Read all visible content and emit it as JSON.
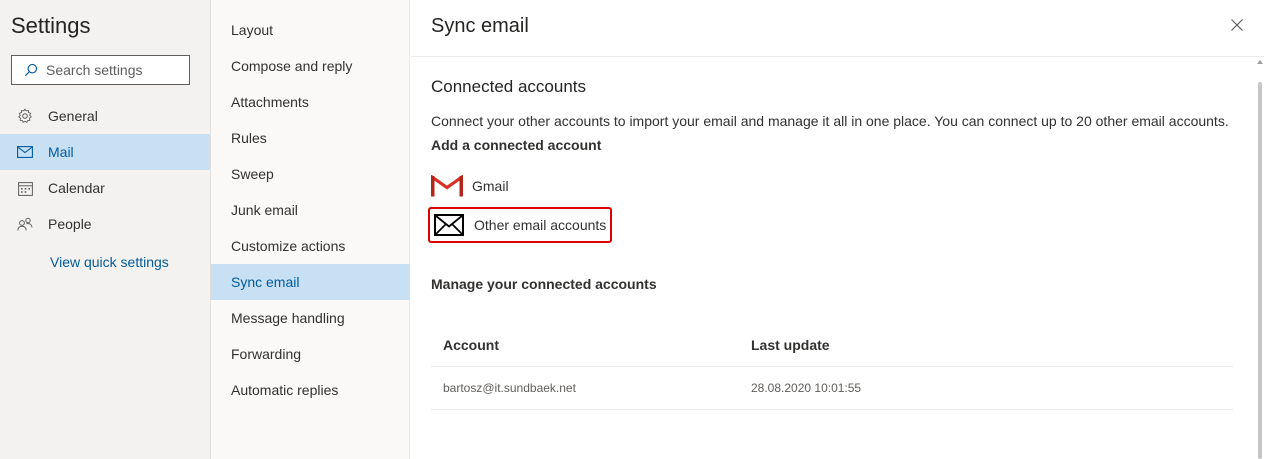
{
  "settings": {
    "title": "Settings",
    "search_placeholder": "Search settings",
    "nav": [
      {
        "label": "General",
        "icon": "gear-icon"
      },
      {
        "label": "Mail",
        "icon": "mail-icon",
        "active": true
      },
      {
        "label": "Calendar",
        "icon": "calendar-icon"
      },
      {
        "label": "People",
        "icon": "people-icon"
      }
    ],
    "quick_settings": "View quick settings"
  },
  "mail_settings": {
    "items": [
      "Layout",
      "Compose and reply",
      "Attachments",
      "Rules",
      "Sweep",
      "Junk email",
      "Customize actions",
      "Sync email",
      "Message handling",
      "Forwarding",
      "Automatic replies"
    ],
    "active_index": 7
  },
  "panel": {
    "title": "Sync email",
    "connected_heading": "Connected accounts",
    "description": "Connect your other accounts to import your email and manage it all in one place. You can connect up to 20 other email accounts.",
    "add_heading": "Add a connected account",
    "options": [
      {
        "label": "Gmail",
        "icon": "gmail-icon"
      },
      {
        "label": "Other email accounts",
        "icon": "envelope-icon"
      }
    ],
    "manage_heading": "Manage your connected accounts",
    "table": {
      "headers": [
        "Account",
        "Last update"
      ],
      "rows": [
        [
          "bartosz@it.sundbaek.net",
          "28.08.2020 10:01:55"
        ]
      ]
    }
  },
  "colors": {
    "active_bg": "#c7e0f4",
    "accent": "#005a9e",
    "highlight_border": "#e00000",
    "gmail_red": "#d93025"
  }
}
